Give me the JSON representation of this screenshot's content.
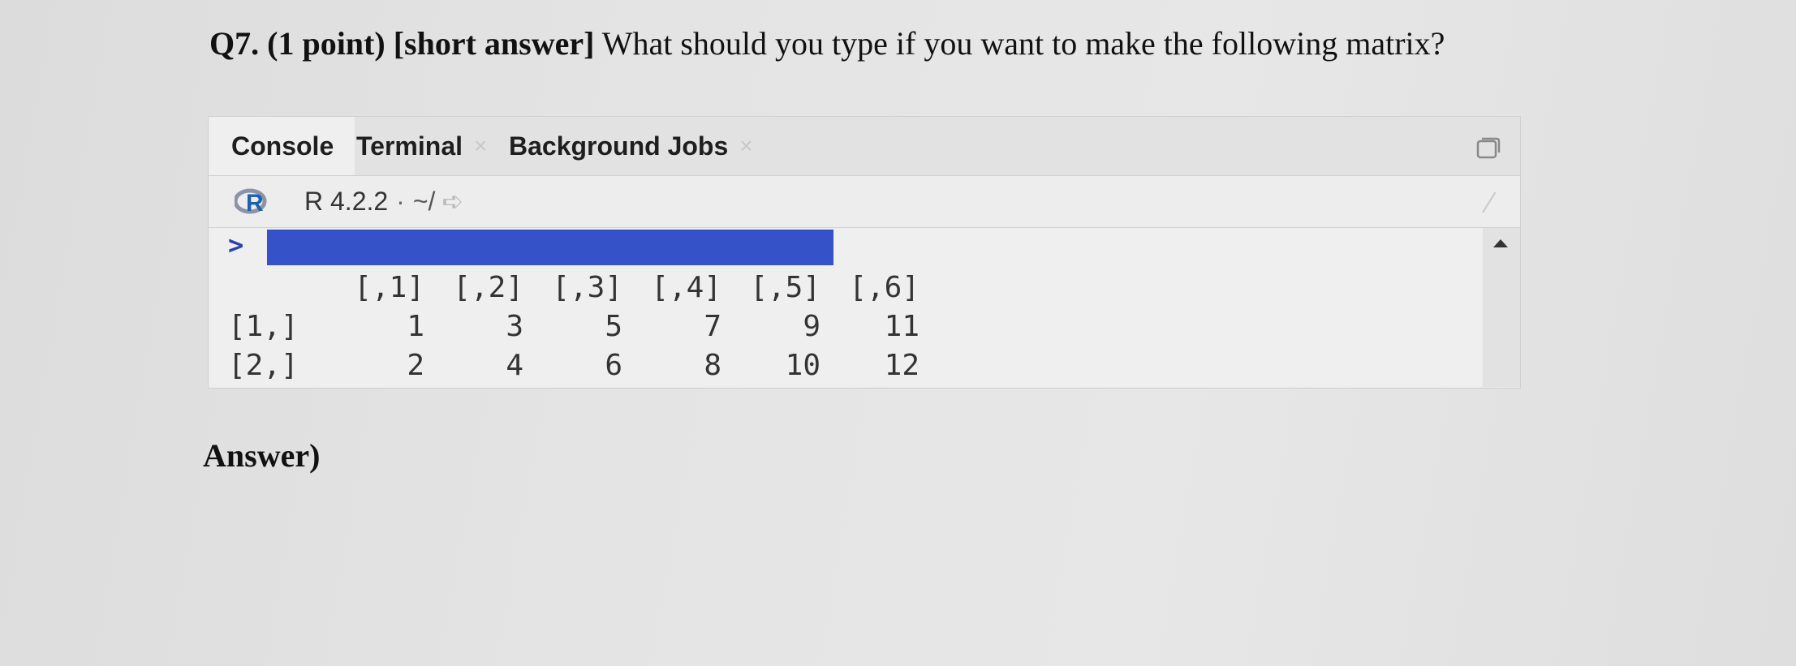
{
  "question": {
    "number": "Q7.",
    "points": "(1 point)",
    "type": "[short answer]",
    "text": "What should you type if you want to make the following matrix?"
  },
  "tabs": [
    {
      "label": "Console",
      "active": true,
      "closable": false
    },
    {
      "label": "Terminal",
      "active": false,
      "closable": true
    },
    {
      "label": "Background Jobs",
      "active": false,
      "closable": true
    }
  ],
  "tab_close_glyph": "×",
  "toolbar": {
    "r_logo": "R",
    "version": "R 4.2.2",
    "separator": "·",
    "path": "~/"
  },
  "console": {
    "prompt": ">",
    "command_highlight_color": "#3652c8",
    "matrix": {
      "col_headers": [
        "[,1]",
        "[,2]",
        "[,3]",
        "[,4]",
        "[,5]",
        "[,6]"
      ],
      "rows": [
        {
          "label": "[1,]",
          "values": [
            "1",
            "3",
            "5",
            "7",
            "9",
            "11"
          ]
        },
        {
          "label": "[2,]",
          "values": [
            "2",
            "4",
            "6",
            "8",
            "10",
            "12"
          ]
        }
      ]
    }
  },
  "answer_label": "Answer)",
  "icons": [
    "r-logo-icon",
    "maximize-icon",
    "go-to-directory-icon",
    "clear-console-icon",
    "scroll-up-icon"
  ]
}
